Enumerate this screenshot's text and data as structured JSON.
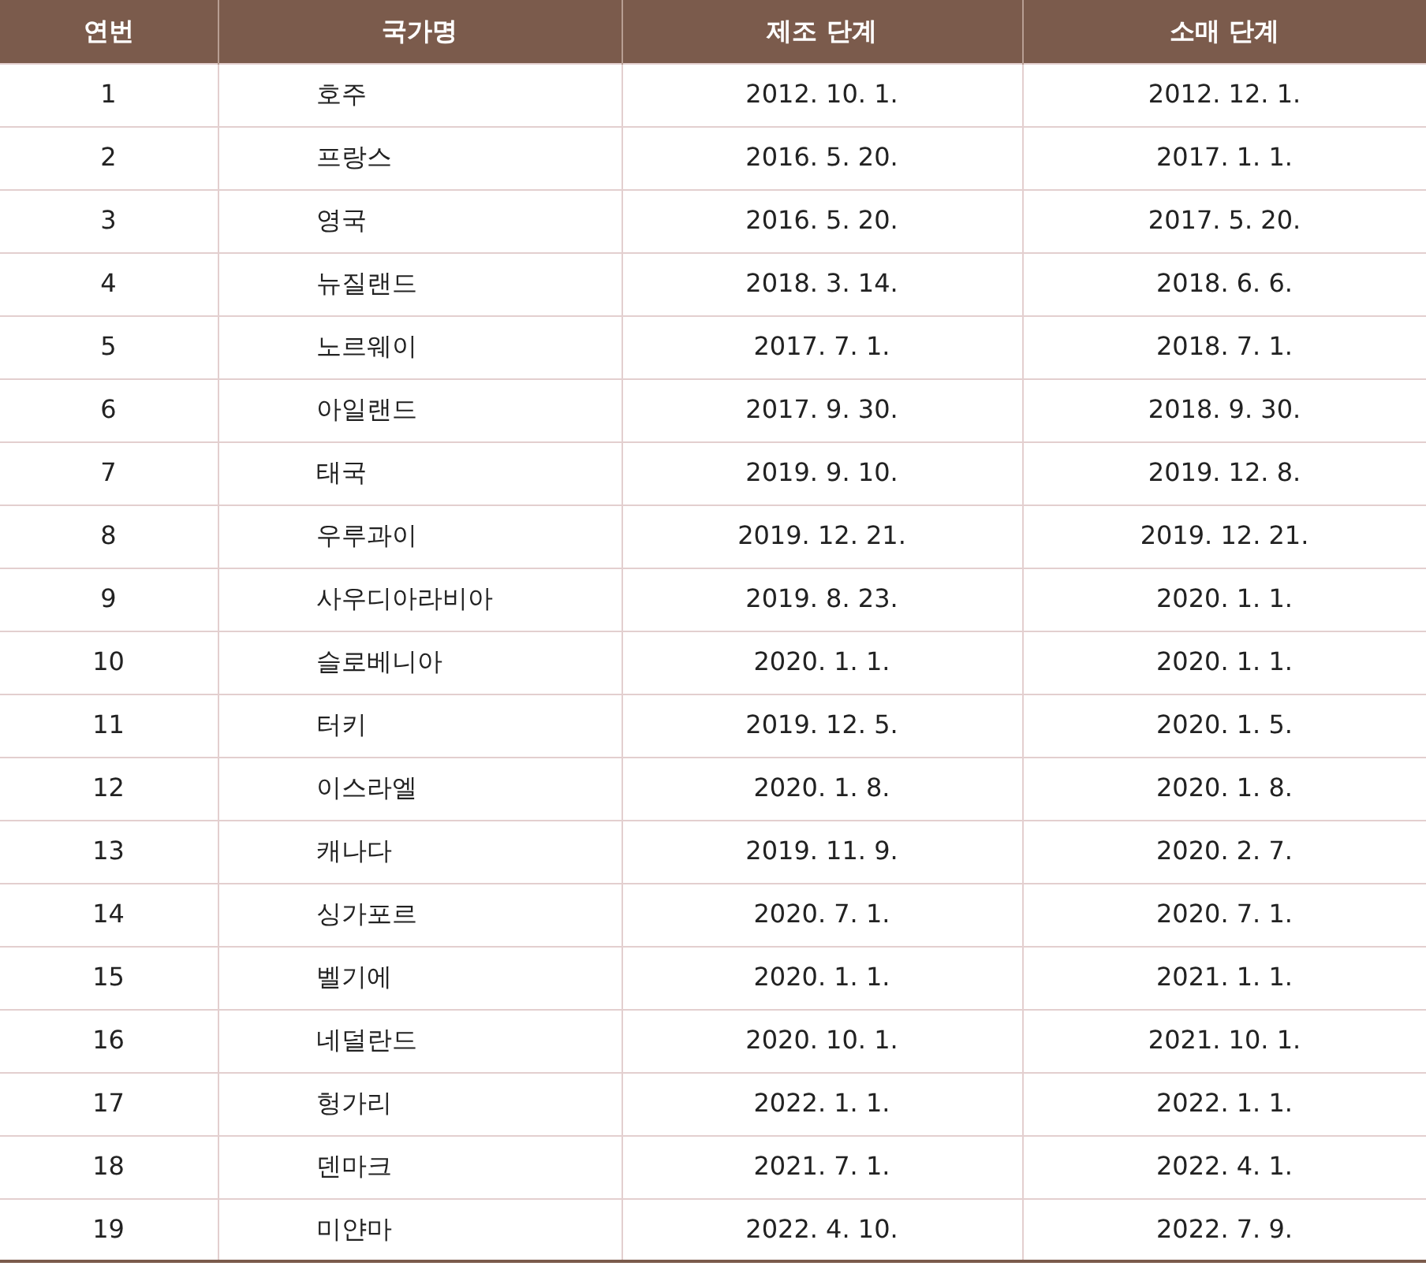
{
  "table": {
    "columns": [
      "연번",
      "국가명",
      "제조 단계",
      "소매 단계"
    ],
    "rows": [
      [
        "1",
        "호주",
        "2012. 10. 1.",
        "2012. 12. 1."
      ],
      [
        "2",
        "프랑스",
        "2016. 5. 20.",
        "2017. 1. 1."
      ],
      [
        "3",
        "영국",
        "2016. 5. 20.",
        "2017. 5. 20."
      ],
      [
        "4",
        "뉴질랜드",
        "2018. 3. 14.",
        "2018. 6. 6."
      ],
      [
        "5",
        "노르웨이",
        "2017. 7. 1.",
        "2018. 7. 1."
      ],
      [
        "6",
        "아일랜드",
        "2017. 9. 30.",
        "2018. 9. 30."
      ],
      [
        "7",
        "태국",
        "2019. 9. 10.",
        "2019. 12. 8."
      ],
      [
        "8",
        "우루과이",
        "2019. 12. 21.",
        "2019. 12. 21."
      ],
      [
        "9",
        "사우디아라비아",
        "2019. 8. 23.",
        "2020. 1. 1."
      ],
      [
        "10",
        "슬로베니아",
        "2020. 1. 1.",
        "2020. 1. 1."
      ],
      [
        "11",
        "터키",
        "2019. 12. 5.",
        "2020. 1. 5."
      ],
      [
        "12",
        "이스라엘",
        "2020. 1. 8.",
        "2020. 1. 8."
      ],
      [
        "13",
        "캐나다",
        "2019. 11. 9.",
        "2020. 2. 7."
      ],
      [
        "14",
        "싱가포르",
        "2020. 7. 1.",
        "2020. 7. 1."
      ],
      [
        "15",
        "벨기에",
        "2020. 1. 1.",
        "2021. 1. 1."
      ],
      [
        "16",
        "네덜란드",
        "2020. 10. 1.",
        "2021. 10. 1."
      ],
      [
        "17",
        "헝가리",
        "2022. 1. 1.",
        "2022. 1. 1."
      ],
      [
        "18",
        "덴마크",
        "2021. 7. 1.",
        "2022. 4. 1."
      ],
      [
        "19",
        "미얀마",
        "2022. 4. 10.",
        "2022. 7. 9."
      ]
    ]
  }
}
